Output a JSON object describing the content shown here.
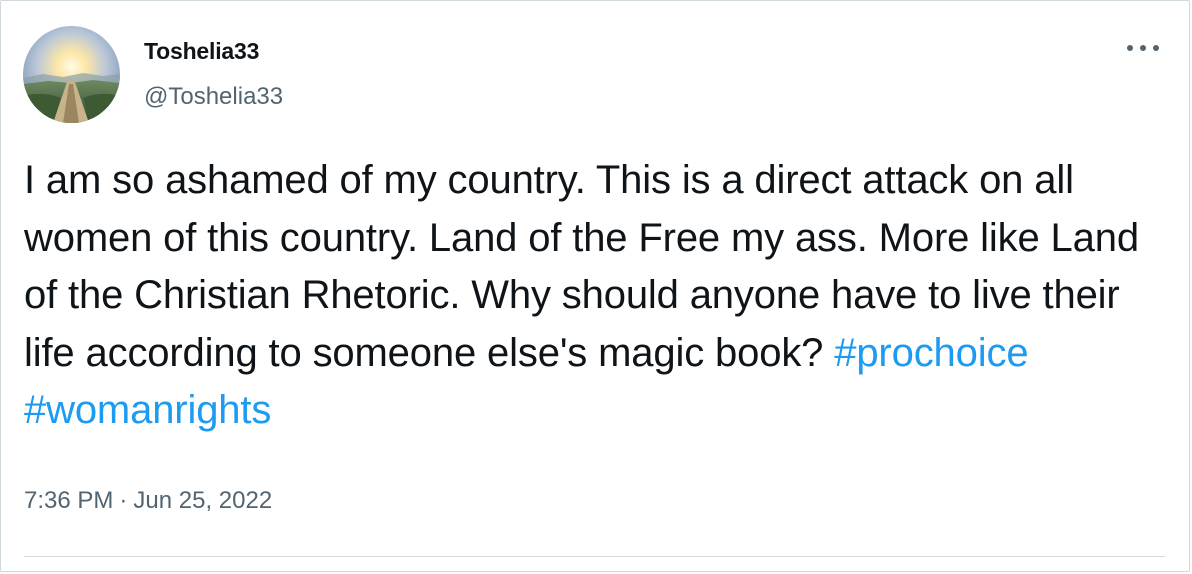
{
  "author": {
    "display_name": "Toshelia33",
    "handle": "@Toshelia33",
    "avatar_icon": "avatar-landscape-sunrise"
  },
  "more_icon": "more-horizontal-icon",
  "tweet": {
    "text_before": "I am so ashamed of my country. This is a direct attack on all women of this country. Land of the Free my ass. More like Land of the Christian Rhetoric. Why should anyone have to live their life according to someone else's magic book? ",
    "hashtags": [
      "#prochoice",
      "#womanrights"
    ]
  },
  "meta": {
    "time": "7:36 PM",
    "separator": "·",
    "date": "Jun 25, 2022"
  },
  "colors": {
    "text": "#0f1419",
    "secondary": "#536471",
    "link": "#1d9bf0",
    "border": "#cfd9de"
  }
}
